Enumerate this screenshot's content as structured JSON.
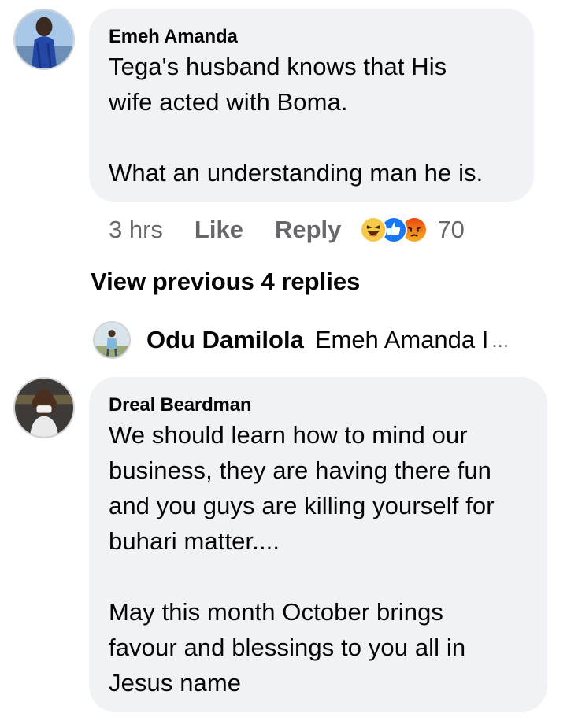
{
  "comments": [
    {
      "author": "Emeh Amanda",
      "text": "Tega's husband knows that His\nwife acted with Boma.\n\nWhat an understanding man he is.",
      "time": "3 hrs",
      "like_label": "Like",
      "reply_label": "Reply",
      "reactions": [
        "haha",
        "like",
        "angry"
      ],
      "reaction_count": "70"
    },
    {
      "author": "Dreal Beardman",
      "text": "We should learn how to mind our\nbusiness, they are having there fun\nand you guys are killing yourself for\nbuhari matter....\n\nMay this month October brings\nfavour and blessings to you all in\nJesus name"
    }
  ],
  "view_previous_label": "View previous 4 replies",
  "reply_preview": {
    "author": "Odu Damilola",
    "snippet": "Emeh Amanda I",
    "ellipsis": "..."
  },
  "colors": {
    "bubble": "#f0f2f5",
    "meta_text": "#65676b",
    "like_blue": "#1877f2",
    "haha_yellow": "#f7c948",
    "angry_orange": "#e9710f"
  }
}
